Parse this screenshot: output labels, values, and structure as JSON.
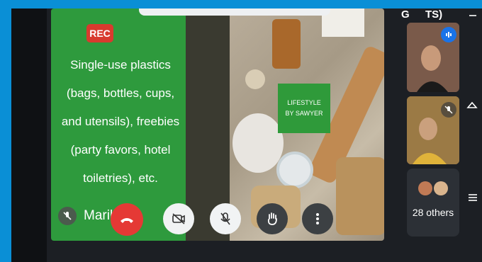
{
  "recording": {
    "label": "REC"
  },
  "slide": {
    "lines": [
      "Single-use plastics",
      "(bags, bottles, cups,",
      "and utensils), freebies",
      "(party favors, hotel",
      "toiletries), etc."
    ]
  },
  "badge": {
    "line1": "LIFESTYLE",
    "line2": "BY SAWYER"
  },
  "presenter": {
    "name": "Maril"
  },
  "participants": {
    "others_label": "28 others"
  },
  "status_bar": {
    "left": "G",
    "right": "TS)"
  },
  "colors": {
    "end_call": "#e53935",
    "slide_green": "#2e9a3d",
    "rec_red": "#d83a2e",
    "speaking_blue": "#1a73e8"
  }
}
